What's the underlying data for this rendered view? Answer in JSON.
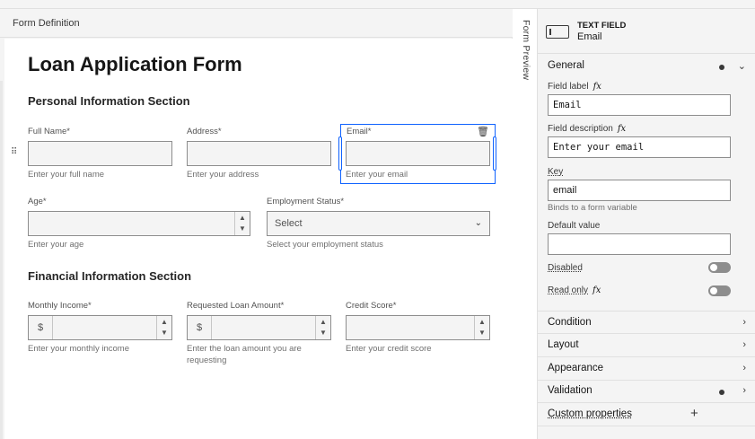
{
  "canvas": {
    "header_title": "Form Definition",
    "form_title": "Loan Application Form",
    "sections": [
      {
        "title": "Personal Information Section"
      },
      {
        "title": "Financial Information Section"
      }
    ],
    "fields": {
      "full_name": {
        "label": "Full Name*",
        "help": "Enter your full name"
      },
      "address": {
        "label": "Address*",
        "help": "Enter your address"
      },
      "email": {
        "label": "Email*",
        "help": "Enter your email"
      },
      "age": {
        "label": "Age*",
        "help": "Enter your age"
      },
      "employment_status": {
        "label": "Employment Status*",
        "placeholder": "Select",
        "help": "Select your employment status"
      },
      "monthly_income": {
        "label": "Monthly Income*",
        "prefix": "$",
        "help": "Enter your monthly income"
      },
      "requested_loan": {
        "label": "Requested Loan Amount*",
        "prefix": "$",
        "help_line1": "Enter the loan amount you are",
        "help_line2": "requesting"
      },
      "credit_score": {
        "label": "Credit Score*",
        "help": "Enter your credit score"
      }
    }
  },
  "vertical_tab": {
    "label": "Form Preview"
  },
  "panel": {
    "component_kind": "TEXT FIELD",
    "component_name": "Email",
    "sections": {
      "general": "General",
      "condition": "Condition",
      "layout": "Layout",
      "appearance": "Appearance",
      "validation": "Validation",
      "custom_properties": "Custom properties"
    },
    "general": {
      "field_label_label": "Field label",
      "field_label_value": "Email",
      "field_description_label": "Field description",
      "field_description_value": "Enter your email",
      "key_label": "Key",
      "key_value": "email",
      "key_help": "Binds to a form variable",
      "default_value_label": "Default value",
      "default_value_value": "",
      "disabled_label": "Disabled",
      "disabled_on": false,
      "read_only_label": "Read only",
      "read_only_on": false
    }
  },
  "icons": {
    "fx": "fx",
    "chevron_down": "⌄",
    "chevron_right": "›",
    "stepper_up": "▲",
    "stepper_down": "▼",
    "drag": "⠿",
    "trash": "🗑",
    "plus": "+"
  },
  "colors": {
    "selection": "#0f62fe",
    "panel_bg": "#f4f4f4",
    "canvas_bg": "#f4f4f4"
  }
}
